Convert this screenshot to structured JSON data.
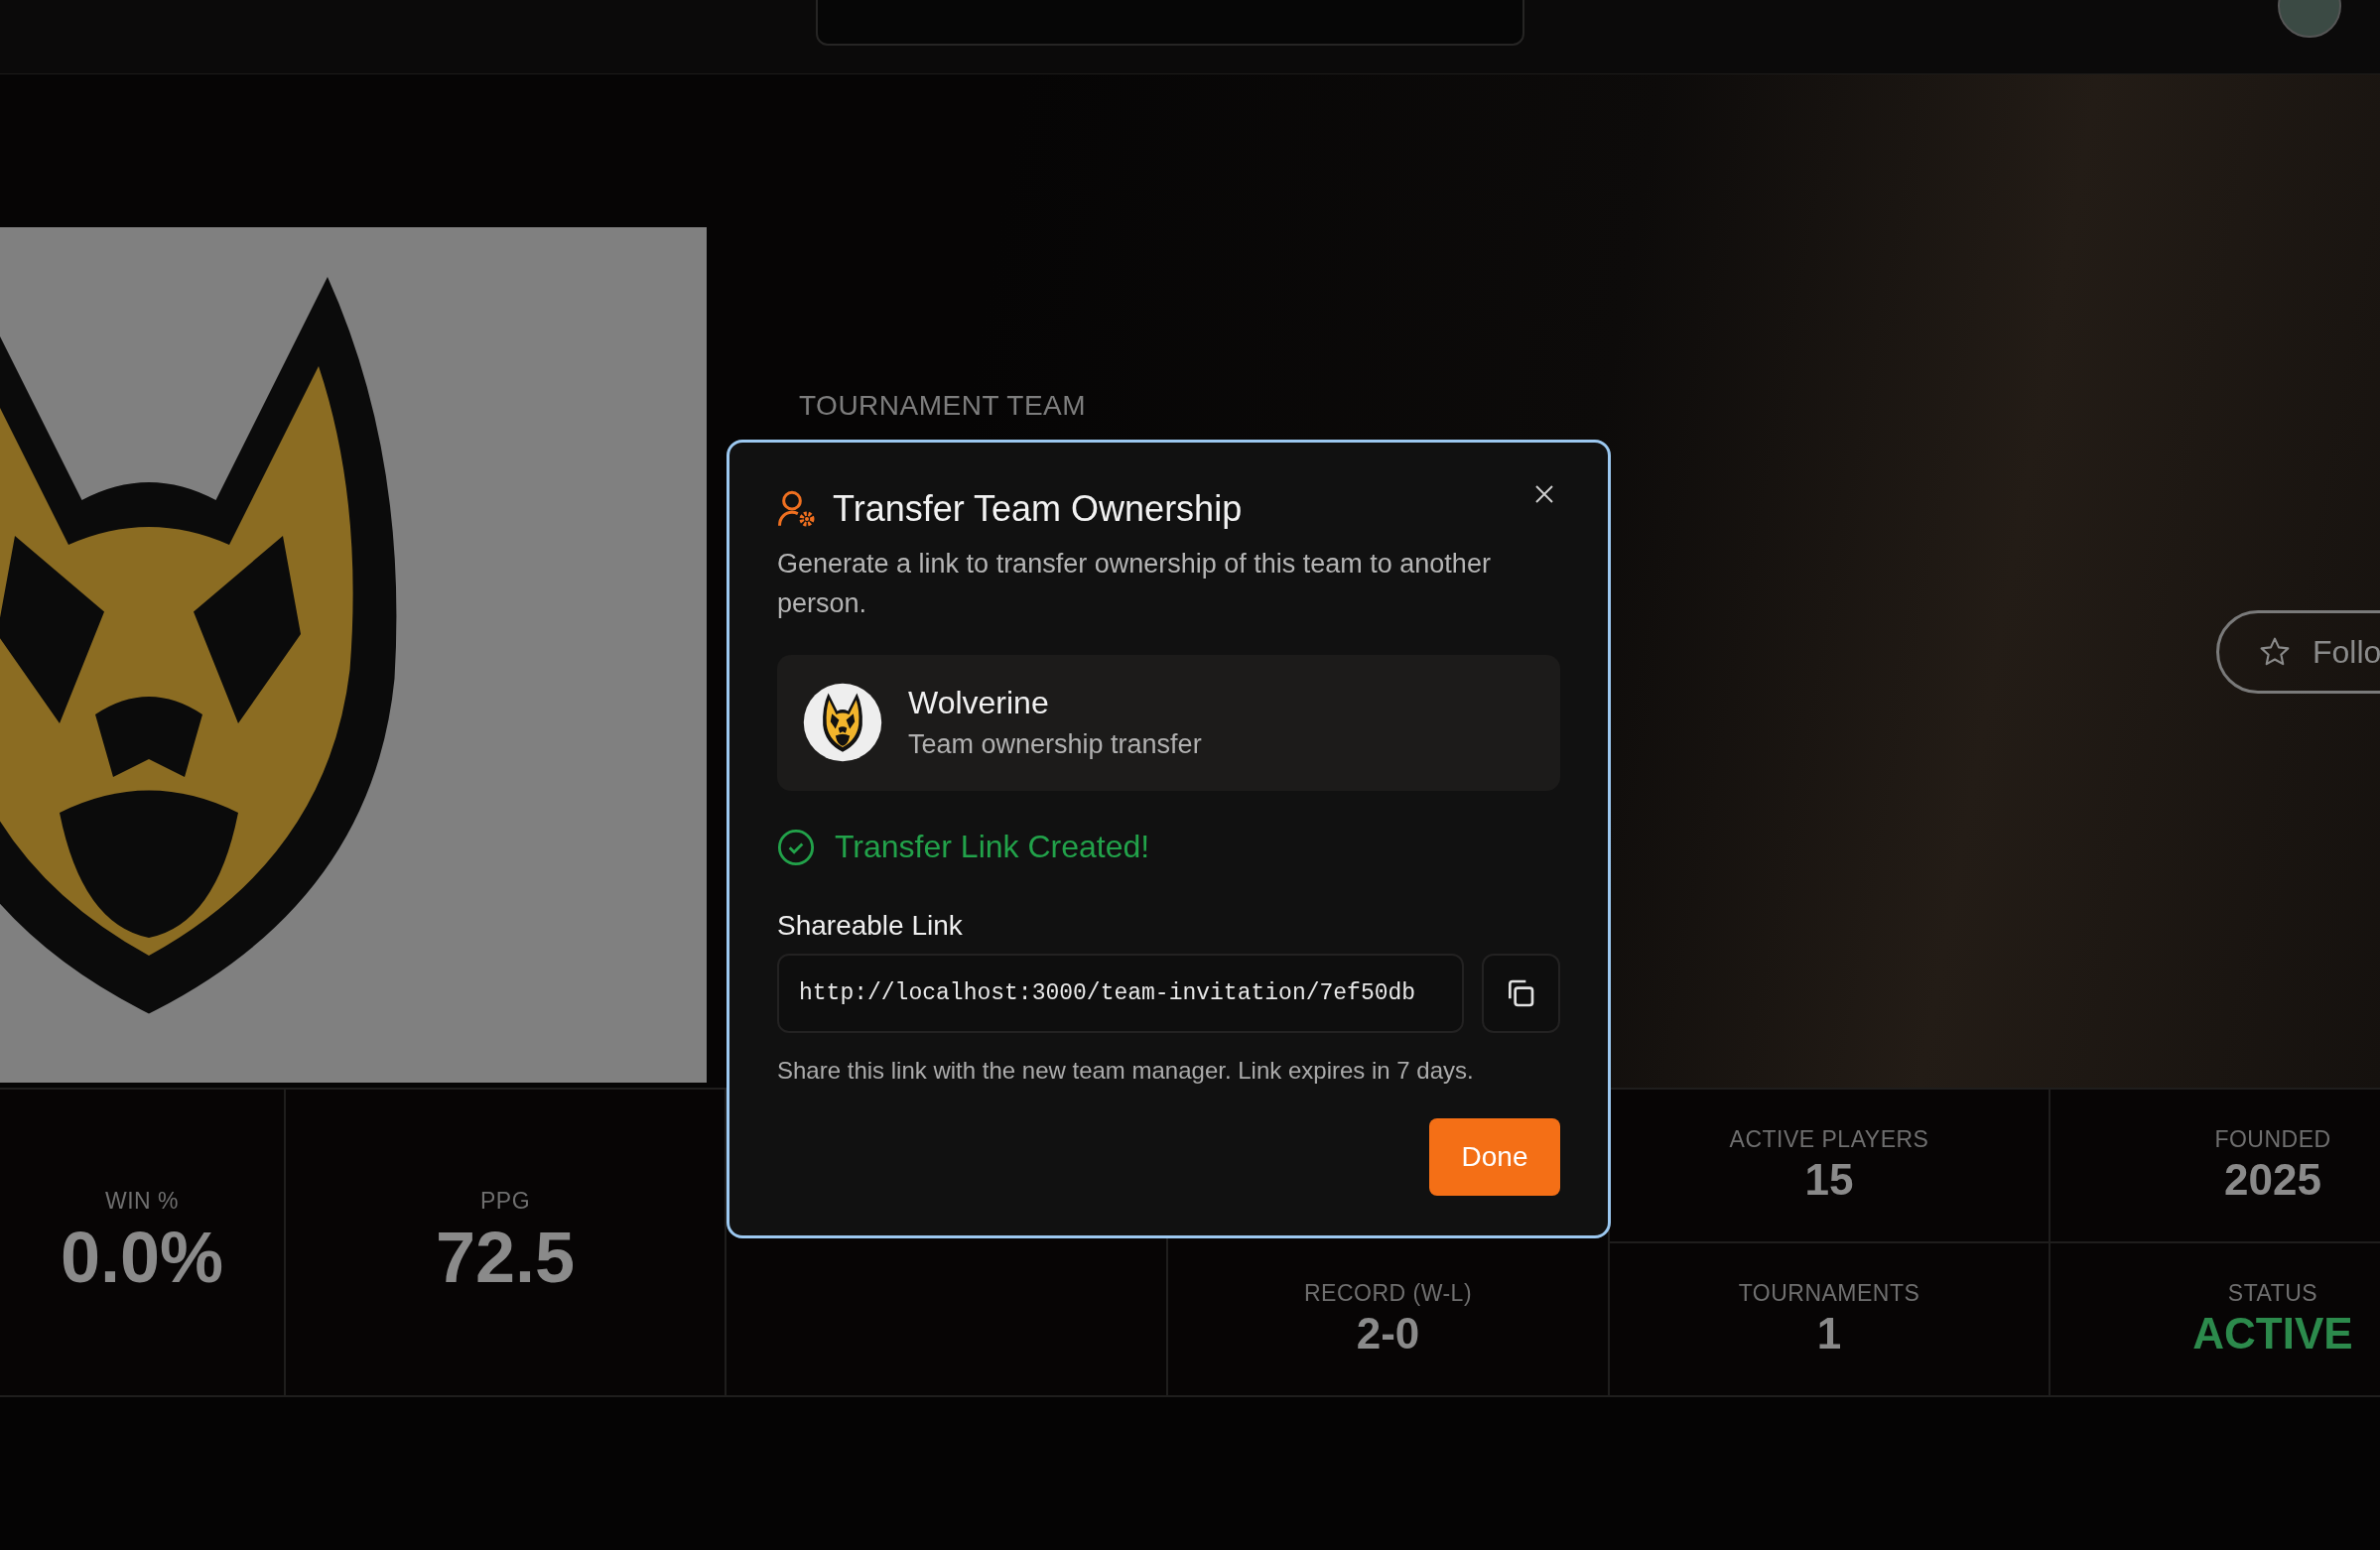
{
  "hero": {
    "category": "TOURNAMENT TEAM",
    "follow_button": "Follo"
  },
  "stats": [
    {
      "kind": "full",
      "cells": [
        {
          "label": "WIN %",
          "value": "0.0%",
          "kind": "metric"
        }
      ]
    },
    {
      "kind": "full",
      "cells": [
        {
          "label": "PPG",
          "value": "72.5",
          "kind": "metric"
        }
      ]
    },
    {
      "kind": "covered"
    },
    {
      "kind": "lower",
      "cells": [
        {
          "label": "RECORD (W-L)",
          "value": "2-0",
          "kind": "metric"
        }
      ]
    },
    {
      "kind": "split",
      "cells": [
        {
          "label": "ACTIVE PLAYERS",
          "value": "15",
          "kind": "metric"
        },
        {
          "label": "TOURNAMENTS",
          "value": "1",
          "kind": "metric"
        }
      ]
    },
    {
      "kind": "split",
      "cells": [
        {
          "label": "FOUNDED",
          "value": "2025",
          "kind": "metric"
        },
        {
          "label": "STATUS",
          "value": "ACTIVE",
          "kind": "status"
        }
      ]
    }
  ],
  "modal": {
    "title": "Transfer Team Ownership",
    "description": "Generate a link to transfer ownership of this team to another person.",
    "team": {
      "name": "Wolverine",
      "subtitle": "Team ownership transfer"
    },
    "status": "Transfer Link Created!",
    "link_label": "Shareable Link",
    "link_value": "http://localhost:3000/team-invitation/7ef50db",
    "hint": "Share this link with the new team manager. Link expires in 7 days.",
    "done_button": "Done"
  }
}
